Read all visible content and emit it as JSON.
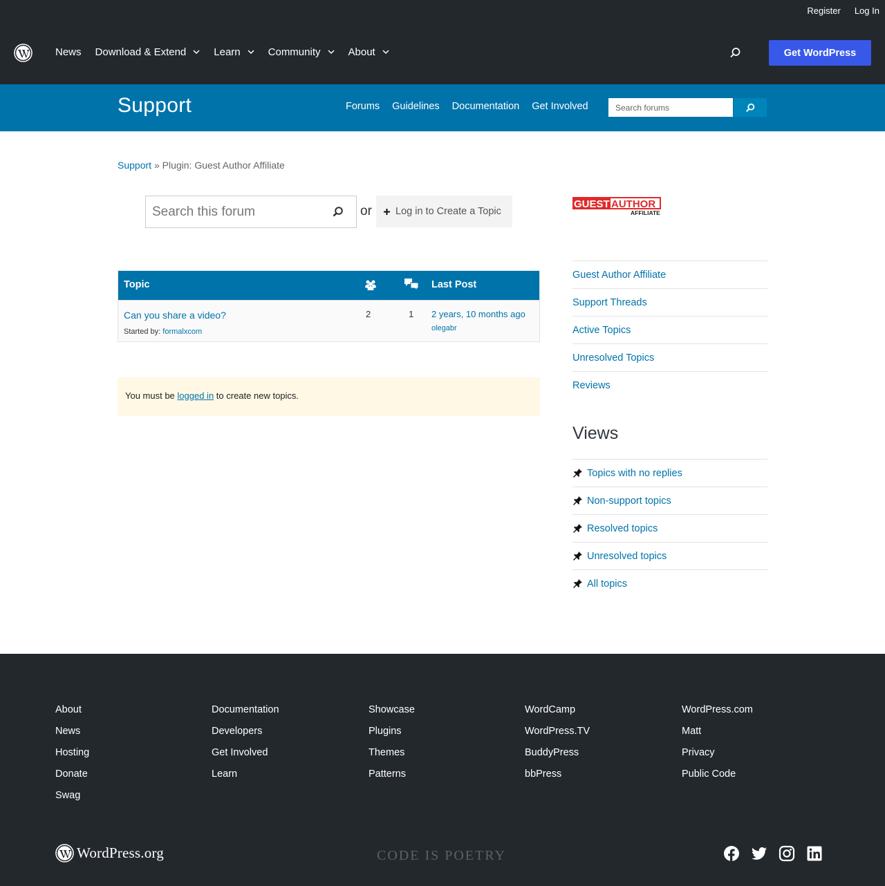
{
  "global_header": {
    "utility_links": [
      "Register",
      "Log In"
    ],
    "nav": [
      {
        "label": "News",
        "has_dropdown": false
      },
      {
        "label": "Download & Extend",
        "has_dropdown": true
      },
      {
        "label": "Learn",
        "has_dropdown": true
      },
      {
        "label": "Community",
        "has_dropdown": true
      },
      {
        "label": "About",
        "has_dropdown": true
      }
    ],
    "get_wordpress_label": "Get WordPress"
  },
  "support_bar": {
    "title": "Support",
    "nav": [
      "Forums",
      "Guidelines",
      "Documentation",
      "Get Involved"
    ],
    "search_placeholder": "Search forums"
  },
  "breadcrumb": {
    "root": "Support",
    "separator": "»",
    "current": "Plugin: Guest Author Affiliate"
  },
  "forum_search": {
    "placeholder": "Search this forum",
    "or_text": "or",
    "create_topic_label": "Log in to Create a Topic"
  },
  "topics_table": {
    "headers": {
      "topic": "Topic",
      "last_post": "Last Post"
    },
    "rows": [
      {
        "title": "Can you share a video?",
        "started_by_label": "Started by:",
        "author": "formalxcom",
        "voices": "2",
        "posts": "1",
        "last_post_time": "2 years, 10 months ago",
        "last_post_author": "olegabr"
      }
    ]
  },
  "notice": {
    "before": "You must be ",
    "link": "logged in",
    "after": " to create new topics."
  },
  "sidebar": {
    "plugin_logo_text": {
      "guest": "GUEST",
      "author": "AUTHOR",
      "affiliate": "AFFILIATE"
    },
    "links": [
      "Guest Author Affiliate",
      "Support Threads",
      "Active Topics",
      "Unresolved Topics",
      "Reviews"
    ],
    "views_title": "Views",
    "views": [
      "Topics with no replies",
      "Non-support topics",
      "Resolved topics",
      "Unresolved topics",
      "All topics"
    ]
  },
  "footer": {
    "columns": [
      [
        "About",
        "News",
        "Hosting",
        "Donate",
        "Swag"
      ],
      [
        "Documentation",
        "Developers",
        "Get Involved",
        "Learn"
      ],
      [
        "Showcase",
        "Plugins",
        "Themes",
        "Patterns"
      ],
      [
        "WordCamp",
        "WordPress.TV",
        "BuddyPress",
        "bbPress"
      ],
      [
        "WordPress.com",
        "Matt",
        "Privacy",
        "Public Code"
      ]
    ],
    "logo_text": "WordPress.org",
    "tagline": "CODE IS POETRY",
    "social_icons": [
      "facebook-icon",
      "twitter-icon",
      "instagram-icon",
      "linkedin-icon"
    ]
  },
  "colors": {
    "header_bg": "#23282d",
    "support_blue": "#0073aa",
    "get_wp_blue": "#3858e9",
    "notice_bg": "#fff8e5",
    "logo_red": "#e02a2a"
  }
}
